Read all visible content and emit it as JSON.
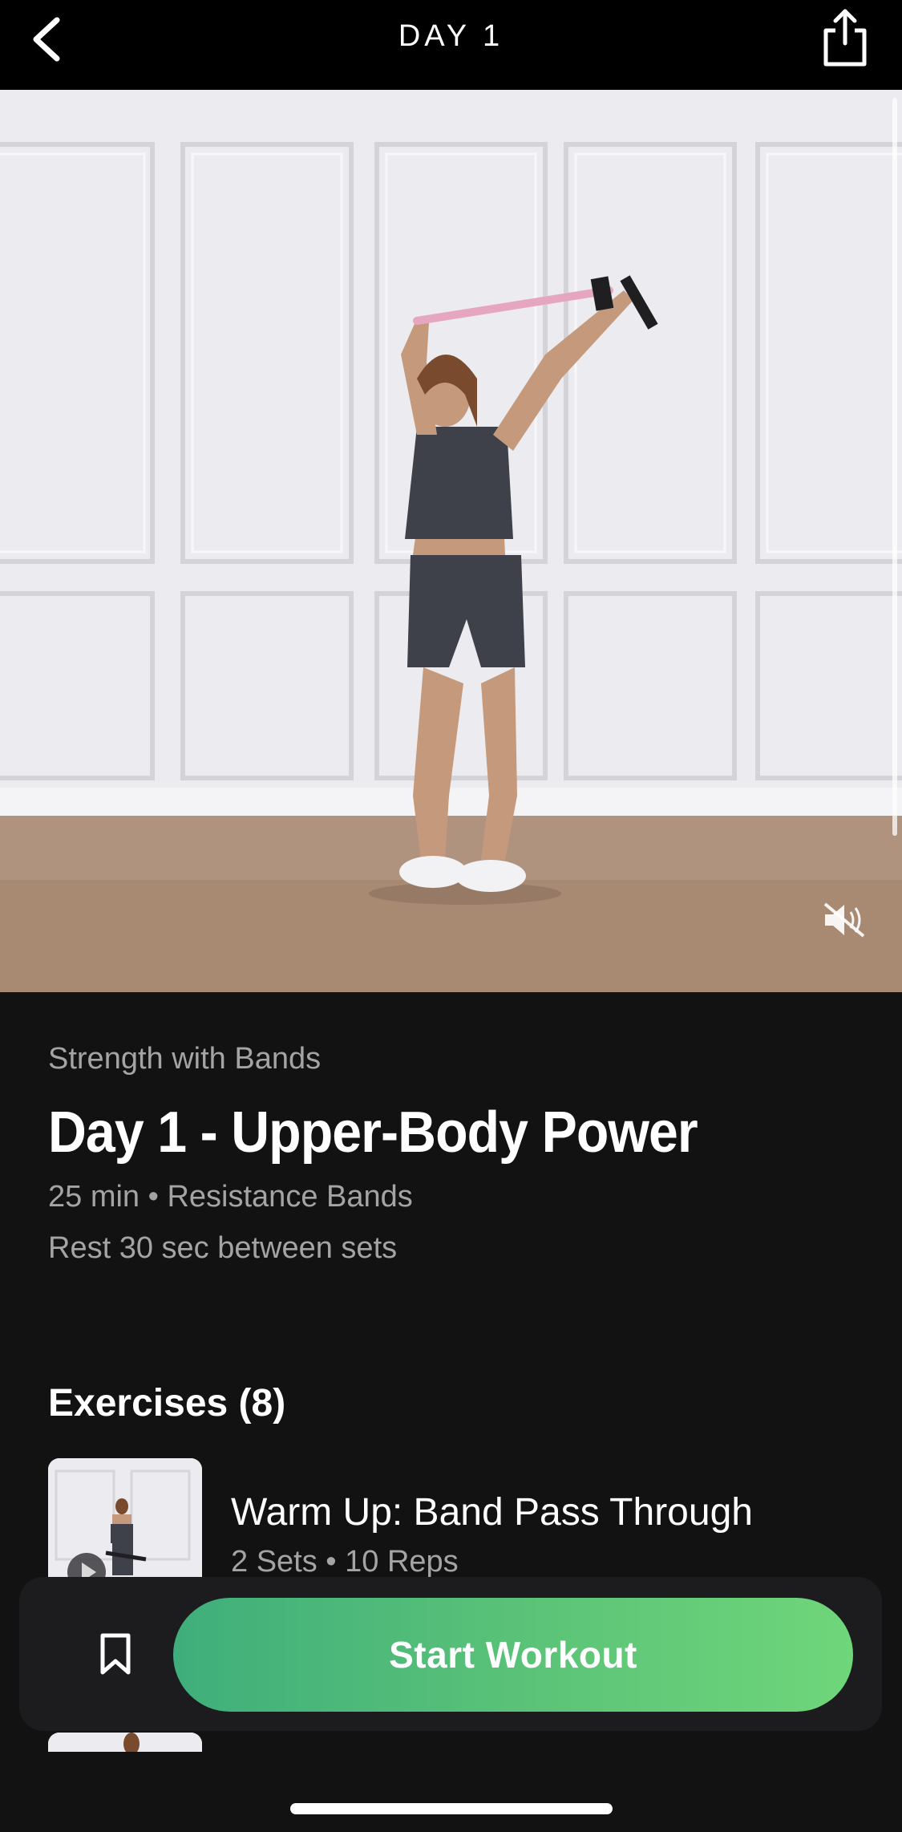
{
  "header": {
    "title": "DAY 1",
    "back_icon": "chevron-left-icon",
    "share_icon": "share-icon"
  },
  "hero": {
    "mute_icon": "speaker-muted-icon"
  },
  "workout": {
    "program": "Strength with Bands",
    "title": "Day 1 - Upper-Body Power",
    "meta": "25 min • Resistance Bands",
    "rest": "Rest 30 sec between sets"
  },
  "exercises": {
    "heading": "Exercises (8)",
    "items": [
      {
        "name": "Warm Up: Band Pass Through",
        "meta": "2 Sets • 10 Reps"
      }
    ]
  },
  "footer": {
    "bookmark_icon": "bookmark-icon",
    "start_label": "Start Workout"
  },
  "colors": {
    "background": "#121212",
    "accent_start": "#3fae7b",
    "accent_end": "#6fd67a"
  }
}
